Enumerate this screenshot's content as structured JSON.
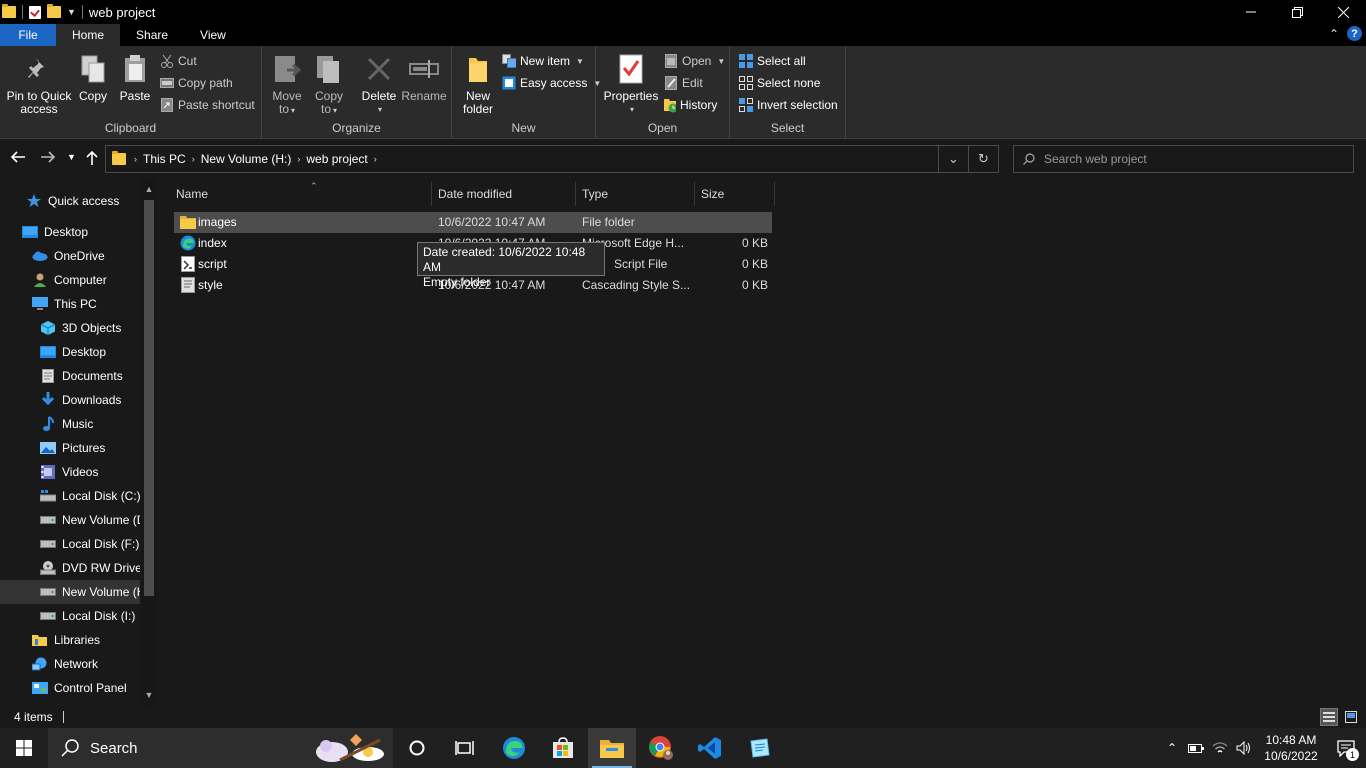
{
  "window": {
    "title": "web project"
  },
  "ribbon_tabs": {
    "file": "File",
    "home": "Home",
    "share": "Share",
    "view": "View"
  },
  "clipboard": {
    "label": "Clipboard",
    "pin_line1": "Pin to Quick",
    "pin_line2": "access",
    "copy": "Copy",
    "paste": "Paste",
    "cut": "Cut",
    "copy_path": "Copy path",
    "paste_shortcut": "Paste shortcut"
  },
  "organize": {
    "label": "Organize",
    "move_line1": "Move",
    "move_line2": "to",
    "copy_line1": "Copy",
    "copy_line2": "to",
    "delete": "Delete",
    "rename": "Rename"
  },
  "new_group": {
    "label": "New",
    "new_folder_line1": "New",
    "new_folder_line2": "folder",
    "new_item": "New item",
    "easy_access": "Easy access"
  },
  "open_group": {
    "label": "Open",
    "properties": "Properties",
    "open": "Open",
    "edit": "Edit",
    "history": "History"
  },
  "select_group": {
    "label": "Select",
    "select_all": "Select all",
    "select_none": "Select none",
    "invert_selection": "Invert selection"
  },
  "address": {
    "crumbs": [
      "This PC",
      "New Volume (H:)",
      "web project"
    ]
  },
  "search": {
    "placeholder": "Search web project"
  },
  "nav": {
    "items": [
      {
        "label": "Quick access"
      },
      {
        "label": "Desktop"
      },
      {
        "label": "OneDrive"
      },
      {
        "label": "Computer"
      },
      {
        "label": "This PC"
      },
      {
        "label": "3D Objects"
      },
      {
        "label": "Desktop"
      },
      {
        "label": "Documents"
      },
      {
        "label": "Downloads"
      },
      {
        "label": "Music"
      },
      {
        "label": "Pictures"
      },
      {
        "label": "Videos"
      },
      {
        "label": "Local Disk (C:)"
      },
      {
        "label": "New Volume (D"
      },
      {
        "label": "Local Disk (F:)"
      },
      {
        "label": "DVD RW Drive"
      },
      {
        "label": "New Volume (H"
      },
      {
        "label": "Local Disk (I:)"
      },
      {
        "label": "Libraries"
      },
      {
        "label": "Network"
      },
      {
        "label": "Control Panel"
      }
    ]
  },
  "columns": {
    "name": "Name",
    "date": "Date modified",
    "type": "Type",
    "size": "Size"
  },
  "files": [
    {
      "name": "images",
      "date": "10/6/2022 10:47 AM",
      "type": "File folder",
      "size": ""
    },
    {
      "name": "index",
      "date": "10/6/2022 10:47 AM",
      "type": "Microsoft Edge H...",
      "size": "0 KB"
    },
    {
      "name": "script",
      "date": "",
      "type": "Script File",
      "size": "0 KB"
    },
    {
      "name": "style",
      "date": "10/6/2022 10:47 AM",
      "type": "Cascading Style S...",
      "size": "0 KB"
    }
  ],
  "tooltip": {
    "line1": "Date created: 10/6/2022 10:48 AM",
    "line2": "Empty folder"
  },
  "status": {
    "count": "4 items"
  },
  "taskbar": {
    "search_label": "Search",
    "time": "10:48 AM",
    "date": "10/6/2022",
    "notification_count": "1"
  },
  "colors": {
    "accent": "#1a66c2",
    "folder": "#f7c948",
    "background": "#191919",
    "ribbon": "#2b2b2b"
  }
}
